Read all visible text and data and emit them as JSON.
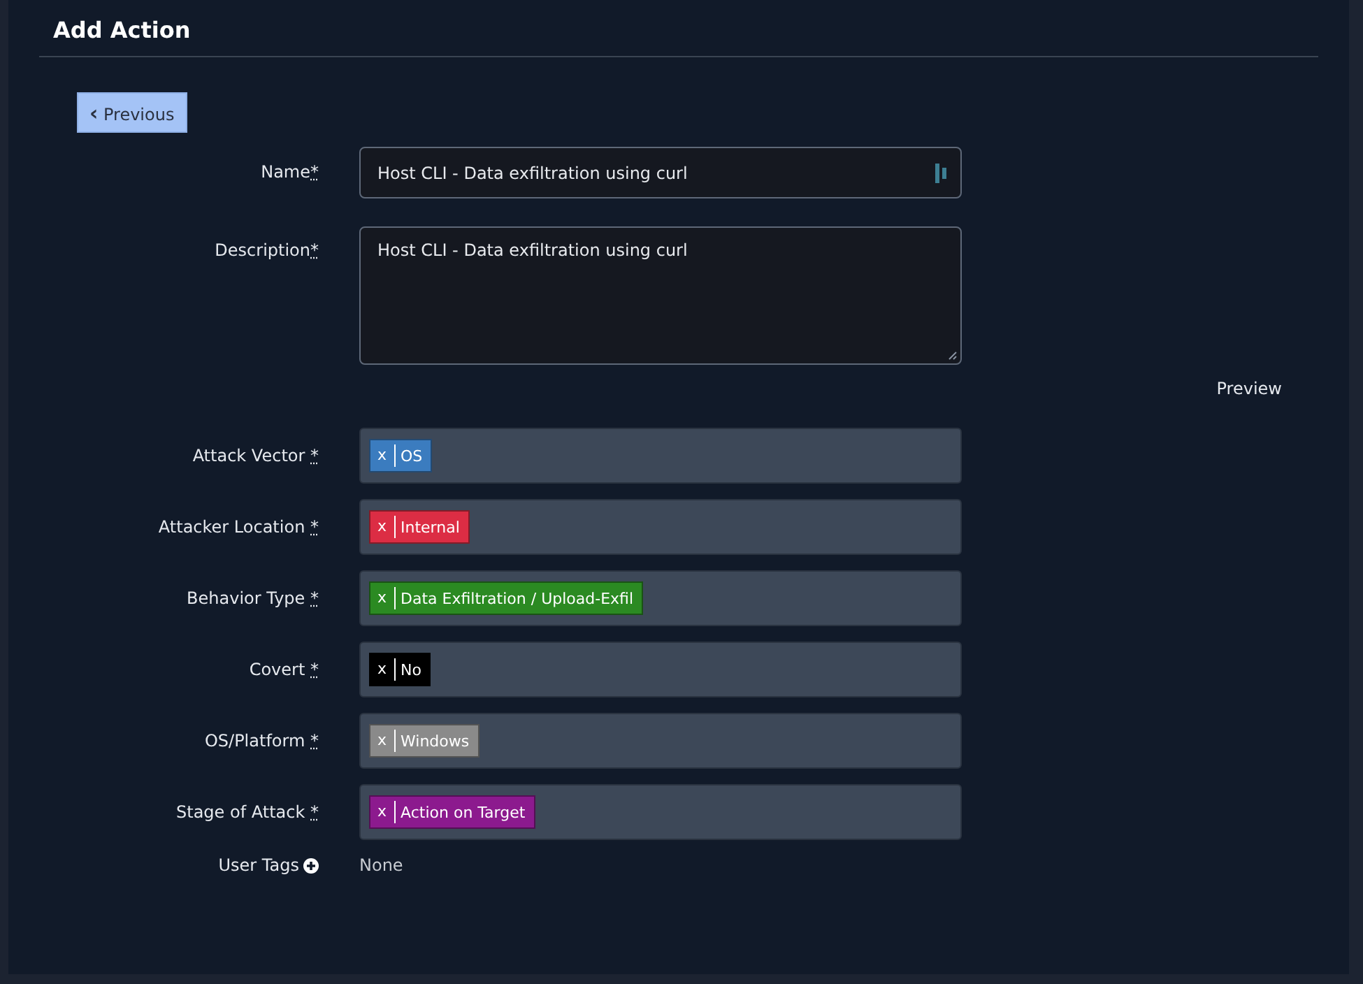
{
  "title": "Add Action",
  "previous_button": {
    "icon": "‹",
    "label": "Previous"
  },
  "fields": [
    {
      "kind": "text",
      "label": "Name",
      "mark": "*",
      "value": "Host CLI - Data exfiltration using curl"
    },
    {
      "kind": "textarea",
      "label": "Description",
      "mark": "*",
      "value": "Host CLI - Data exfiltration using curl"
    }
  ],
  "preview_link": "Preview",
  "tag_fields": [
    {
      "label": "Attack Vector",
      "mark": "*",
      "tags": [
        {
          "remove": "x",
          "label": "OS",
          "color": "#3b7cbf"
        }
      ]
    },
    {
      "label": "Attacker Location",
      "mark": "*",
      "tags": [
        {
          "remove": "x",
          "label": "Internal",
          "color": "#dc2d44"
        }
      ]
    },
    {
      "label": "Behavior Type",
      "mark": "*",
      "tags": [
        {
          "remove": "x",
          "label": "Data Exfiltration / Upload-Exfil",
          "color": "#2b8a22"
        }
      ]
    },
    {
      "label": "Covert",
      "mark": "*",
      "tags": [
        {
          "remove": "x",
          "label": "No",
          "color": "#000000"
        }
      ]
    },
    {
      "label": "OS/Platform",
      "mark": "*",
      "tags": [
        {
          "remove": "x",
          "label": "Windows",
          "color": "#8a8a8a"
        }
      ]
    },
    {
      "label": "Stage of Attack",
      "mark": "*",
      "tags": [
        {
          "remove": "x",
          "label": "Action on Target",
          "color": "#8c1a8e"
        }
      ]
    }
  ],
  "user_tags": {
    "label": "User Tags",
    "value": "None"
  }
}
